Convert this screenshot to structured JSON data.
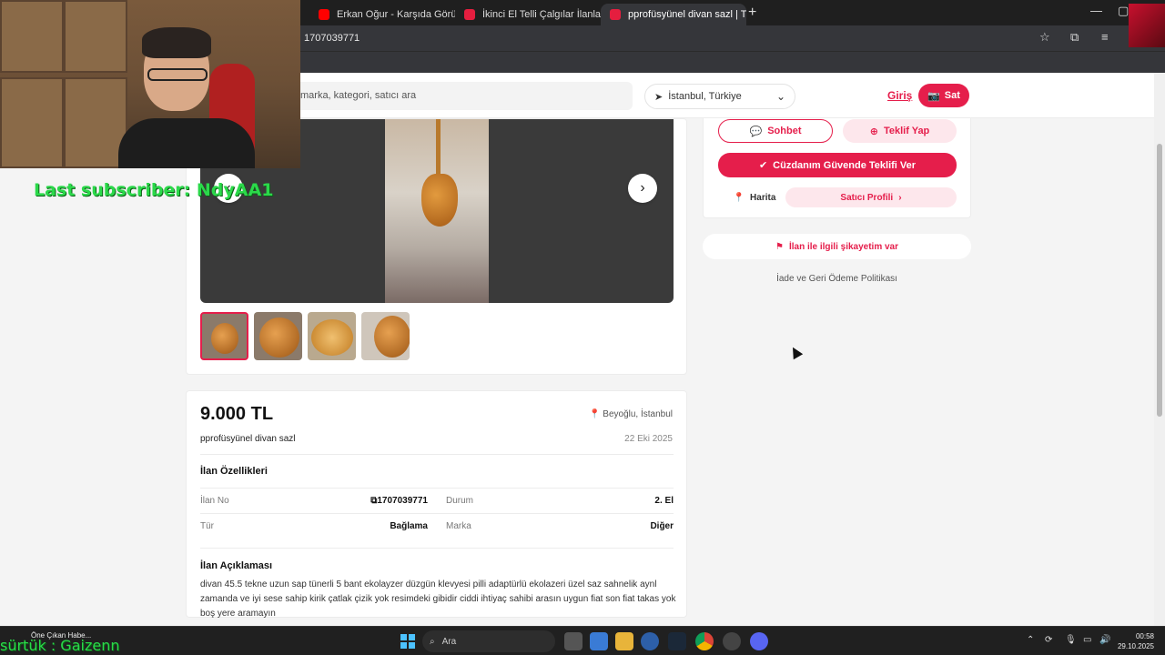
{
  "browser": {
    "tabs": [
      {
        "title": "Erkan Oğur - Karşıda Görün",
        "icon": "youtube-icon"
      },
      {
        "title": "İkinci El Telli Çalgılar İlanları ve",
        "icon": "site-icon"
      },
      {
        "title": "pprofüsyünel divan sazl | Türkiy",
        "icon": "site-icon"
      }
    ],
    "address": "1707039771"
  },
  "header": {
    "search_placeholder": "marka, kategori, satıcı ara",
    "location": "İstanbul, Türkiye",
    "login": "Giriş",
    "sell": "Sat"
  },
  "actions": {
    "chat": "Sohbet",
    "offer": "Teklif Yap",
    "wallet_offer": "Cüzdanım Güvende Teklifi Ver",
    "map": "Harita",
    "seller_profile": "Satıcı Profili",
    "complaint": "İlan ile ilgili şikayetim var",
    "refund_policy": "İade ve Geri Ödeme Politikası"
  },
  "listing": {
    "price": "9.000 TL",
    "location": "Beyoğlu, İstanbul",
    "title": "pprofüsyünel divan sazl",
    "date": "22 Eki 2025",
    "features_heading": "İlan Özellikleri",
    "props": {
      "listing_no_label": "İlan No",
      "listing_no_value": "1707039771",
      "condition_label": "Durum",
      "condition_value": "2. El",
      "type_label": "Tür",
      "type_value": "Bağlama",
      "brand_label": "Marka",
      "brand_value": "Diğer"
    },
    "description_heading": "İlan Açıklaması",
    "description": "divan 45.5 tekne uzun sap tünerli 5 bant ekolayzer düzgün klevyesi pilli adaptürlü ekolazeri üzel saz sahnelik aynl zamanda ve iyi sese sahip kirik çatlak çizik yok resimdeki gibidir ciddi ihtiyaç sahibi arasın uygun fiat son fiat takas yok boş yere aramayın"
  },
  "overlay": {
    "last_subscriber": "Last subscriber: NdyAA1",
    "donor_text": "sürtük : Gaizenn"
  },
  "taskbar": {
    "news_title": "Öne Çıkan Habe...",
    "search": "Ara",
    "time": "00:58",
    "date": "29.10.2025"
  },
  "colors": {
    "brand": "#e51e4b",
    "overlay_green": "#2bd94a"
  }
}
